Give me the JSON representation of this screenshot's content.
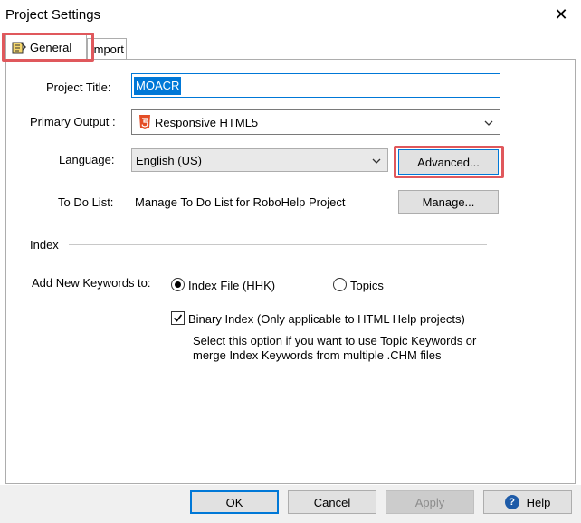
{
  "window": {
    "title": "Project Settings",
    "close_glyph": "✕"
  },
  "tabs": [
    {
      "label": "General",
      "icon": "general-settings-icon"
    },
    {
      "label": "Import"
    }
  ],
  "general": {
    "project_title": {
      "label": "Project Title:",
      "value": "MOACR"
    },
    "primary_output": {
      "label": "Primary Output :",
      "value": "Responsive HTML5",
      "icon": "html5-icon"
    },
    "language": {
      "label": "Language:",
      "value": "English (US)",
      "advanced_label": "Advanced..."
    },
    "todo": {
      "label": "To Do List:",
      "text": "Manage To Do List for RoboHelp Project",
      "manage_label": "Manage..."
    },
    "index": {
      "section_label": "Index",
      "add_keywords_label": "Add New Keywords to:",
      "radio_index_file": "Index File (HHK)",
      "radio_topics": "Topics",
      "selected": "Index File (HHK)",
      "binary_index_label": "Binary Index (Only applicable to HTML Help projects)",
      "binary_index_checked": true,
      "binary_note_line1": "Select this option if you want to use Topic Keywords or",
      "binary_note_line2": "merge Index Keywords  from multiple .CHM files"
    }
  },
  "buttons": {
    "ok": "OK",
    "cancel": "Cancel",
    "apply": "Apply",
    "help": "Help"
  },
  "colors": {
    "highlight": "#e0585c",
    "selection": "#0078d7",
    "help_icon": "#1e5ba8"
  }
}
